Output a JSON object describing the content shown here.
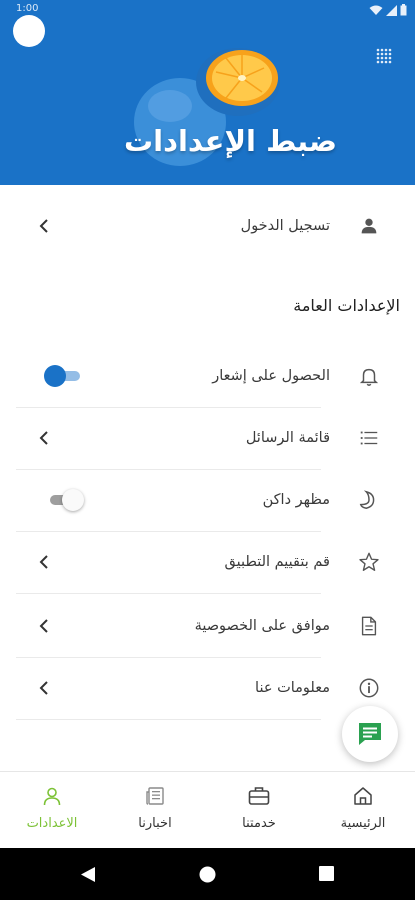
{
  "status_bar": {
    "time": "1:00"
  },
  "header": {
    "title": "ضبط الإعدادات"
  },
  "account": {
    "login_label": "تسجيل الدخول"
  },
  "general_settings": {
    "title": "الإعدادات العامة",
    "items": [
      {
        "label": "الحصول على إشعار",
        "icon": "bell-icon",
        "control": "toggle",
        "on": true
      },
      {
        "label": "قائمة الرسائل",
        "icon": "list-icon",
        "control": "chevron"
      },
      {
        "label": "مظهر داكن",
        "icon": "moon-icon",
        "control": "toggle",
        "on": false
      },
      {
        "label": "قم بتقييم التطبيق",
        "icon": "star-icon",
        "control": "chevron"
      },
      {
        "label": "موافق على الخصوصية",
        "icon": "document-icon",
        "control": "chevron"
      },
      {
        "label": "معلومات عنا",
        "icon": "info-icon",
        "control": "chevron"
      }
    ]
  },
  "bottom_nav": {
    "items": [
      {
        "label": "الرئيسية",
        "icon": "home-icon",
        "active": false
      },
      {
        "label": "خدمتنا",
        "icon": "briefcase-icon",
        "active": false
      },
      {
        "label": "اخبارنا",
        "icon": "news-icon",
        "active": false
      },
      {
        "label": "الاعدادات",
        "icon": "user-icon",
        "active": true
      }
    ]
  },
  "colors": {
    "primary": "#1a72c7",
    "accent": "#7cc236",
    "fab_icon": "#2aa150"
  }
}
